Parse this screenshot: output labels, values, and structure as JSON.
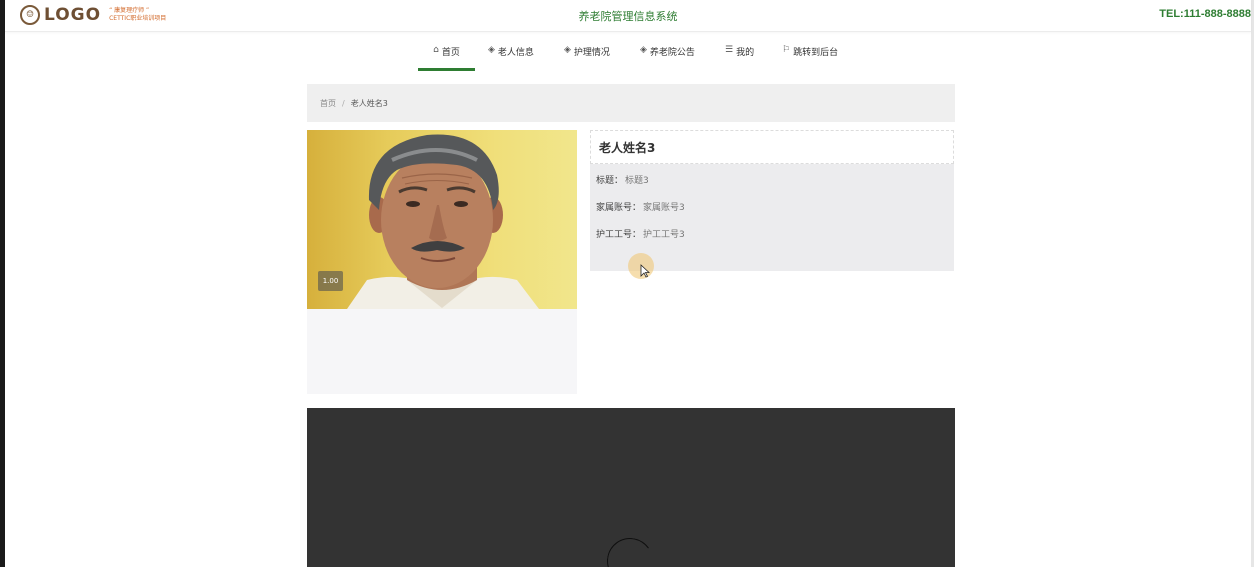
{
  "header": {
    "logo_text": "LOGO",
    "logo_sub_line1": "“ 康复理疗师 ”",
    "logo_sub_line2": "CETTIC职业培训项目",
    "site_title": "养老院管理信息系统",
    "tel": "TEL:111-888-8888"
  },
  "nav": {
    "items": [
      {
        "label": "首页",
        "icon": "home-icon",
        "active": true
      },
      {
        "label": "老人信息",
        "icon": "box-icon",
        "active": false
      },
      {
        "label": "护理情况",
        "icon": "box-icon",
        "active": false
      },
      {
        "label": "养老院公告",
        "icon": "box-icon",
        "active": false
      },
      {
        "label": "我的",
        "icon": "menu-icon",
        "active": false
      },
      {
        "label": "跳转到后台",
        "icon": "flag-icon",
        "active": false
      }
    ]
  },
  "breadcrumb": {
    "home": "首页",
    "separator": "/",
    "current": "老人姓名3"
  },
  "photo": {
    "badge": "1.00"
  },
  "detail": {
    "name": "老人姓名3",
    "fields": [
      {
        "label": "标题：",
        "value": "标题3"
      },
      {
        "label": "家属账号：",
        "value": "家属账号3"
      },
      {
        "label": "护工工号：",
        "value": "护工工号3"
      }
    ]
  },
  "colors": {
    "accent_green": "#2e7d32",
    "video_bg": "#333333"
  }
}
